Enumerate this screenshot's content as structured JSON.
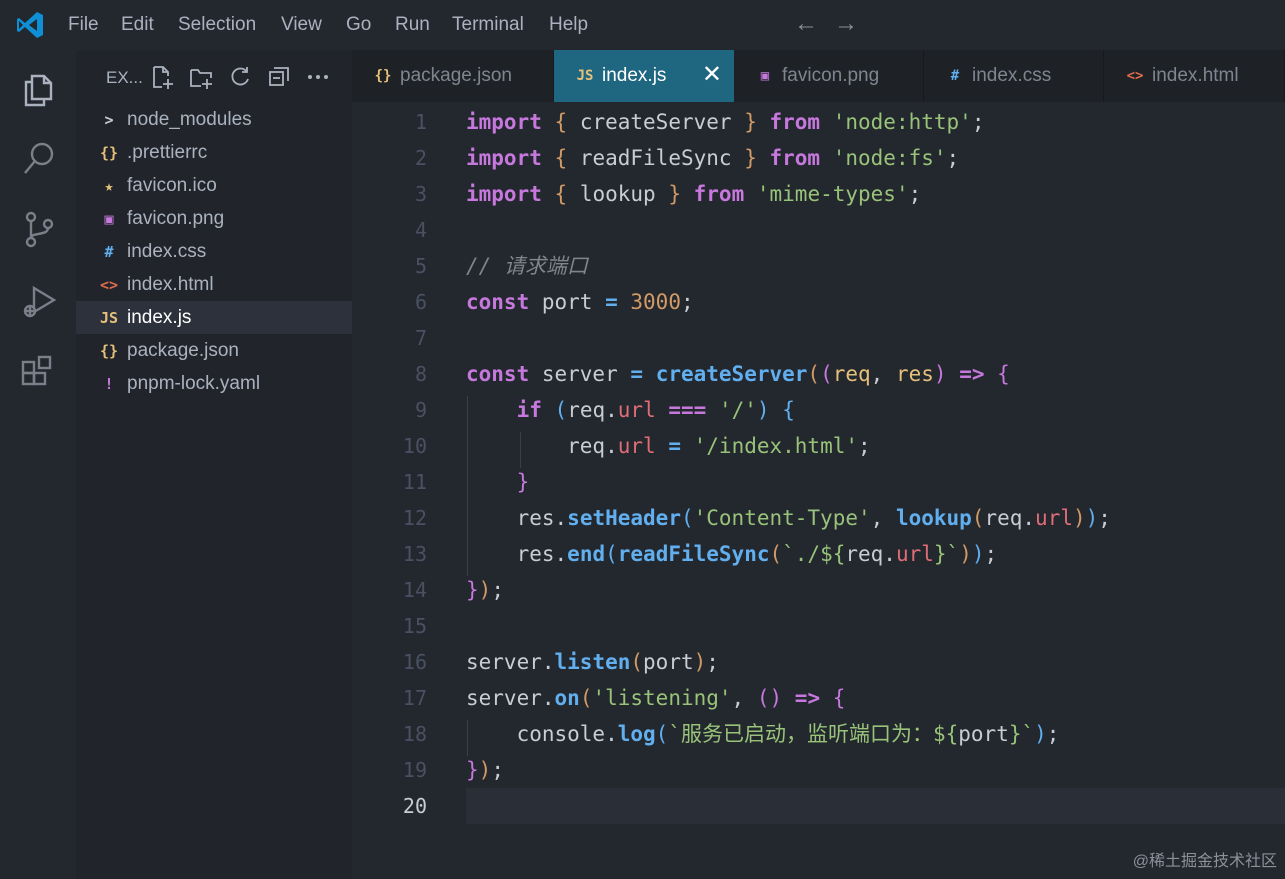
{
  "menu": [
    "File",
    "Edit",
    "Selection",
    "View",
    "Go",
    "Run",
    "Terminal",
    "Help"
  ],
  "nav": {
    "back": "←",
    "forward": "→"
  },
  "activity_icons": [
    "files-icon",
    "search-icon",
    "source-control-icon",
    "run-debug-icon",
    "extensions-icon"
  ],
  "sidebar": {
    "title": "EX...",
    "tools": [
      "new-file-icon",
      "new-folder-icon",
      "refresh-icon",
      "collapse-all-icon",
      "more-icon"
    ],
    "items": [
      {
        "label": "node_modules",
        "icon": ">",
        "icon_name": "chevron-right-icon",
        "color": "#c8ccd4",
        "active": false
      },
      {
        "label": ".prettierrc",
        "icon": "{}",
        "icon_name": "json-icon",
        "color": "#e5c07b",
        "active": false
      },
      {
        "label": "favicon.ico",
        "icon": "★",
        "icon_name": "star-icon",
        "color": "#e5c07b",
        "active": false
      },
      {
        "label": "favicon.png",
        "icon": "▣",
        "icon_name": "image-icon",
        "color": "#c678dd",
        "active": false
      },
      {
        "label": "index.css",
        "icon": "#",
        "icon_name": "css-icon",
        "color": "#61afef",
        "active": false
      },
      {
        "label": "index.html",
        "icon": "<>",
        "icon_name": "html-icon",
        "color": "#e06c4b",
        "active": false
      },
      {
        "label": "index.js",
        "icon": "JS",
        "icon_name": "js-icon",
        "color": "#e5c07b",
        "active": true
      },
      {
        "label": "package.json",
        "icon": "{}",
        "icon_name": "json-icon",
        "color": "#e5c07b",
        "active": false
      },
      {
        "label": "pnpm-lock.yaml",
        "icon": "!",
        "icon_name": "yaml-icon",
        "color": "#c678dd",
        "active": false
      }
    ]
  },
  "tabs": [
    {
      "label": "package.json",
      "icon": "{}",
      "icon_name": "json-icon",
      "color": "#e5c07b",
      "active": false
    },
    {
      "label": "index.js",
      "icon": "JS",
      "icon_name": "js-icon",
      "color": "#e5c07b",
      "active": true,
      "close": "✕"
    },
    {
      "label": "favicon.png",
      "icon": "▣",
      "icon_name": "image-icon",
      "color": "#c678dd",
      "active": false
    },
    {
      "label": "index.css",
      "icon": "#",
      "icon_name": "css-icon",
      "color": "#61afef",
      "active": false
    },
    {
      "label": "index.html",
      "icon": "<>",
      "icon_name": "html-icon",
      "color": "#e06c4b",
      "active": false
    }
  ],
  "theme": {
    "keyword": "#c678dd",
    "function": "#61afef",
    "string": "#98c379",
    "number": "#d19a66",
    "property": "#e06c75",
    "comment": "#7f848e",
    "plain": "#c8ccd4",
    "bracket1": "#d19a66",
    "bracket2": "#c678dd",
    "bracket3": "#61afef",
    "param": "#e5c07b"
  },
  "editor": {
    "current_line": 20,
    "lines": [
      {
        "n": "1",
        "tokens": [
          [
            "import",
            "keyword"
          ],
          [
            " ",
            "plain"
          ],
          [
            "{",
            "bracket1"
          ],
          [
            " createServer ",
            "plain"
          ],
          [
            "}",
            "bracket1"
          ],
          [
            " ",
            "plain"
          ],
          [
            "from",
            "keyword"
          ],
          [
            " ",
            "plain"
          ],
          [
            "'node:http'",
            "string"
          ],
          [
            ";",
            "plain"
          ]
        ]
      },
      {
        "n": "2",
        "tokens": [
          [
            "import",
            "keyword"
          ],
          [
            " ",
            "plain"
          ],
          [
            "{",
            "bracket1"
          ],
          [
            " readFileSync ",
            "plain"
          ],
          [
            "}",
            "bracket1"
          ],
          [
            " ",
            "plain"
          ],
          [
            "from",
            "keyword"
          ],
          [
            " ",
            "plain"
          ],
          [
            "'node:fs'",
            "string"
          ],
          [
            ";",
            "plain"
          ]
        ]
      },
      {
        "n": "3",
        "tokens": [
          [
            "import",
            "keyword"
          ],
          [
            " ",
            "plain"
          ],
          [
            "{",
            "bracket1"
          ],
          [
            " lookup ",
            "plain"
          ],
          [
            "}",
            "bracket1"
          ],
          [
            " ",
            "plain"
          ],
          [
            "from",
            "keyword"
          ],
          [
            " ",
            "plain"
          ],
          [
            "'mime-types'",
            "string"
          ],
          [
            ";",
            "plain"
          ]
        ]
      },
      {
        "n": "4",
        "tokens": []
      },
      {
        "n": "5",
        "tokens": [
          [
            "// 请求端口",
            "comment"
          ]
        ]
      },
      {
        "n": "6",
        "tokens": [
          [
            "const",
            "keyword"
          ],
          [
            " port ",
            "plain"
          ],
          [
            "=",
            "function"
          ],
          [
            " ",
            "plain"
          ],
          [
            "3000",
            "number"
          ],
          [
            ";",
            "plain"
          ]
        ]
      },
      {
        "n": "7",
        "tokens": []
      },
      {
        "n": "8",
        "tokens": [
          [
            "const",
            "keyword"
          ],
          [
            " server ",
            "plain"
          ],
          [
            "=",
            "function"
          ],
          [
            " ",
            "plain"
          ],
          [
            "createServer",
            "function"
          ],
          [
            "(",
            "bracket1"
          ],
          [
            "(",
            "bracket2"
          ],
          [
            "req",
            "param"
          ],
          [
            ", ",
            "plain"
          ],
          [
            "res",
            "param"
          ],
          [
            ")",
            "bracket2"
          ],
          [
            " ",
            "plain"
          ],
          [
            "=>",
            "keyword"
          ],
          [
            " ",
            "plain"
          ],
          [
            "{",
            "bracket2"
          ]
        ]
      },
      {
        "n": "9",
        "tokens": [
          [
            "    ",
            "plain"
          ],
          [
            "if",
            "keyword"
          ],
          [
            " ",
            "plain"
          ],
          [
            "(",
            "bracket3"
          ],
          [
            "req",
            "plain"
          ],
          [
            ".",
            "plain"
          ],
          [
            "url",
            "property"
          ],
          [
            " ",
            "plain"
          ],
          [
            "===",
            "keyword"
          ],
          [
            " ",
            "plain"
          ],
          [
            "'/'",
            "string"
          ],
          [
            ")",
            "bracket3"
          ],
          [
            " ",
            "plain"
          ],
          [
            "{",
            "bracket3"
          ]
        ]
      },
      {
        "n": "10",
        "tokens": [
          [
            "        req",
            "plain"
          ],
          [
            ".",
            "plain"
          ],
          [
            "url",
            "property"
          ],
          [
            " ",
            "plain"
          ],
          [
            "=",
            "function"
          ],
          [
            " ",
            "plain"
          ],
          [
            "'/index.html'",
            "string"
          ],
          [
            ";",
            "plain"
          ]
        ]
      },
      {
        "n": "11",
        "tokens": [
          [
            "    ",
            "plain"
          ],
          [
            "}",
            "bracket2"
          ]
        ]
      },
      {
        "n": "12",
        "tokens": [
          [
            "    res",
            "plain"
          ],
          [
            ".",
            "plain"
          ],
          [
            "setHeader",
            "function"
          ],
          [
            "(",
            "bracket3"
          ],
          [
            "'Content-Type'",
            "string"
          ],
          [
            ", ",
            "plain"
          ],
          [
            "lookup",
            "function"
          ],
          [
            "(",
            "bracket1"
          ],
          [
            "req",
            "plain"
          ],
          [
            ".",
            "plain"
          ],
          [
            "url",
            "property"
          ],
          [
            ")",
            "bracket1"
          ],
          [
            ")",
            "bracket3"
          ],
          [
            ";",
            "plain"
          ]
        ]
      },
      {
        "n": "13",
        "tokens": [
          [
            "    res",
            "plain"
          ],
          [
            ".",
            "plain"
          ],
          [
            "end",
            "function"
          ],
          [
            "(",
            "bracket3"
          ],
          [
            "readFileSync",
            "function"
          ],
          [
            "(",
            "bracket1"
          ],
          [
            "`./${",
            "string"
          ],
          [
            "req",
            "plain"
          ],
          [
            ".",
            "plain"
          ],
          [
            "url",
            "property"
          ],
          [
            "}`",
            "string"
          ],
          [
            ")",
            "bracket1"
          ],
          [
            ")",
            "bracket3"
          ],
          [
            ";",
            "plain"
          ]
        ]
      },
      {
        "n": "14",
        "tokens": [
          [
            "}",
            "bracket2"
          ],
          [
            ")",
            "bracket1"
          ],
          [
            ";",
            "plain"
          ]
        ]
      },
      {
        "n": "15",
        "tokens": []
      },
      {
        "n": "16",
        "tokens": [
          [
            "server",
            "plain"
          ],
          [
            ".",
            "plain"
          ],
          [
            "listen",
            "function"
          ],
          [
            "(",
            "bracket1"
          ],
          [
            "port",
            "plain"
          ],
          [
            ")",
            "bracket1"
          ],
          [
            ";",
            "plain"
          ]
        ]
      },
      {
        "n": "17",
        "tokens": [
          [
            "server",
            "plain"
          ],
          [
            ".",
            "plain"
          ],
          [
            "on",
            "function"
          ],
          [
            "(",
            "bracket1"
          ],
          [
            "'listening'",
            "string"
          ],
          [
            ", ",
            "plain"
          ],
          [
            "()",
            "bracket2"
          ],
          [
            " ",
            "plain"
          ],
          [
            "=>",
            "keyword"
          ],
          [
            " ",
            "plain"
          ],
          [
            "{",
            "bracket2"
          ]
        ]
      },
      {
        "n": "18",
        "tokens": [
          [
            "    console",
            "plain"
          ],
          [
            ".",
            "plain"
          ],
          [
            "log",
            "function"
          ],
          [
            "(",
            "bracket3"
          ],
          [
            "`服务已启动，监听端口为：${",
            "string"
          ],
          [
            "port",
            "plain"
          ],
          [
            "}`",
            "string"
          ],
          [
            ")",
            "bracket3"
          ],
          [
            ";",
            "plain"
          ]
        ]
      },
      {
        "n": "19",
        "tokens": [
          [
            "}",
            "bracket2"
          ],
          [
            ")",
            "bracket1"
          ],
          [
            ";",
            "plain"
          ]
        ]
      },
      {
        "n": "20",
        "tokens": []
      }
    ]
  },
  "watermark": "@稀土掘金技术社区"
}
